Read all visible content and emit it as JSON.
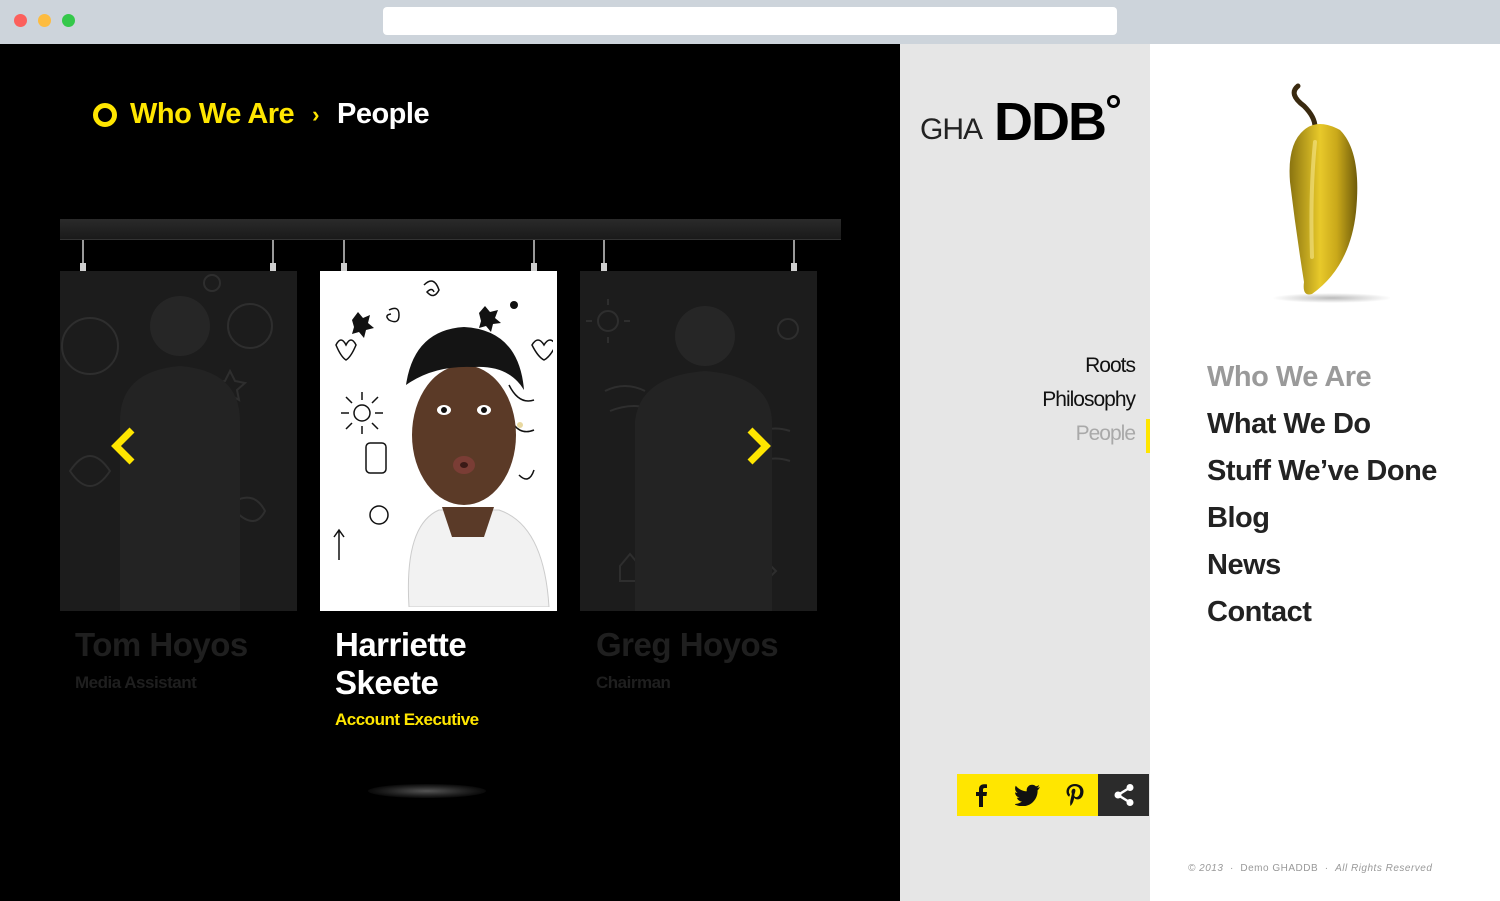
{
  "breadcrumb": {
    "root": "Who We Are",
    "separator": "›",
    "current": "People"
  },
  "people": [
    {
      "name": "Tom Hoyos",
      "role": "Media Assistant",
      "active": false
    },
    {
      "name": "Harriette Skeete",
      "name_line1": "Harriette",
      "name_line2": "Skeete",
      "role": "Account Executive",
      "active": true
    },
    {
      "name": "Greg Hoyos",
      "role": "Chairman",
      "active": false
    }
  ],
  "logo": {
    "prefix": "GHA",
    "brand": "DDB"
  },
  "subnav": {
    "items": [
      "Roots",
      "Philosophy",
      "People"
    ],
    "current": "People"
  },
  "mainnav": {
    "items": [
      "Who We Are",
      "What We Do",
      "Stuff We’ve Done",
      "Blog",
      "News",
      "Contact"
    ],
    "current": "Who We Are"
  },
  "social": [
    "facebook-icon",
    "twitter-icon",
    "pinterest-icon",
    "share-icon"
  ],
  "footer": {
    "year": "© 2013",
    "sep": "·",
    "site": "Demo GHADDB",
    "rights": "All Rights Reserved"
  },
  "colors": {
    "accent": "#ffe600",
    "stage": "#000000",
    "sidebar": "#e6e6e6"
  }
}
